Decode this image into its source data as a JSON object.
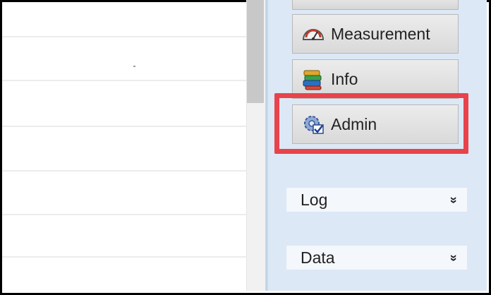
{
  "nav": {
    "items": [
      {
        "label": "Measurement",
        "icon": "gauge-icon"
      },
      {
        "label": "Info",
        "icon": "books-icon"
      },
      {
        "label": "Admin",
        "icon": "gear-check-icon"
      }
    ],
    "highlighted": "Admin"
  },
  "sections": [
    {
      "label": "Log",
      "icon": "chevron-double-down-icon"
    },
    {
      "label": "Data",
      "icon": "chevron-double-down-icon"
    }
  ],
  "colors": {
    "highlight": "#e8434b",
    "panel": "#dce8f5",
    "button": "#e0e0e0"
  }
}
